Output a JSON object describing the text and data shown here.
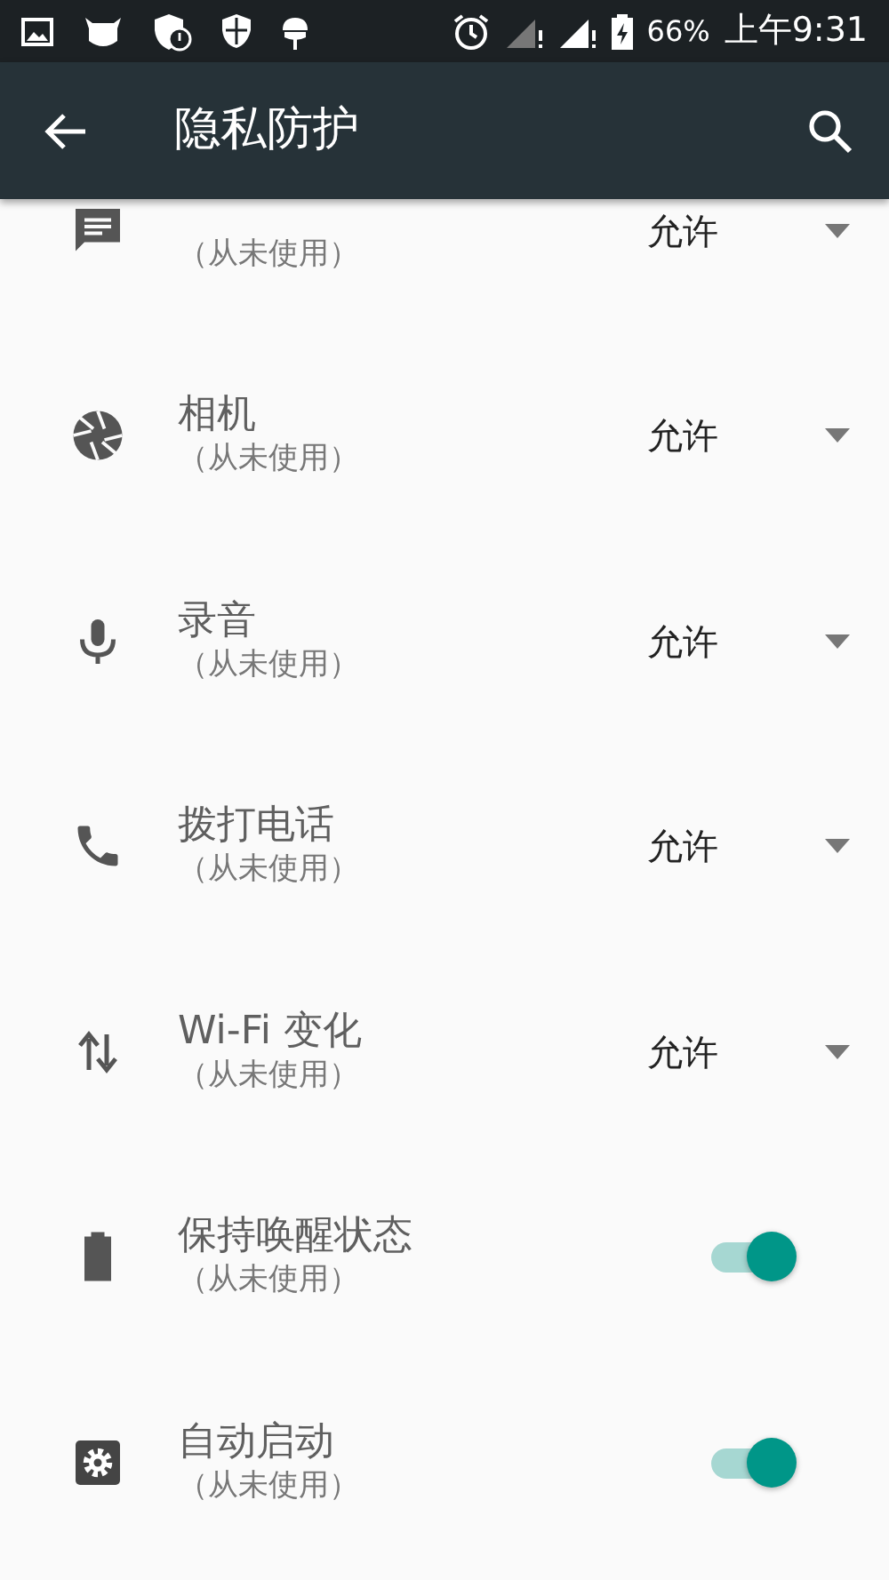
{
  "status_bar": {
    "battery": "66%",
    "time": "上午9:31"
  },
  "app_bar": {
    "title": "隐私防护"
  },
  "rows": [
    {
      "kind": "dropdown",
      "subtitle": "（从未使用）",
      "value": "允许"
    },
    {
      "kind": "dropdown",
      "title": "相机",
      "subtitle": "（从未使用）",
      "value": "允许"
    },
    {
      "kind": "dropdown",
      "title": "录音",
      "subtitle": "（从未使用）",
      "value": "允许"
    },
    {
      "kind": "dropdown",
      "title": "拨打电话",
      "subtitle": "（从未使用）",
      "value": "允许"
    },
    {
      "kind": "dropdown",
      "title": "Wi-Fi 变化",
      "subtitle": "（从未使用）",
      "value": "允许"
    },
    {
      "kind": "switch",
      "title": "保持唤醒状态",
      "subtitle": "（从未使用）",
      "on": true
    },
    {
      "kind": "switch",
      "title": "自动启动",
      "subtitle": "（从未使用）",
      "on": true
    }
  ]
}
